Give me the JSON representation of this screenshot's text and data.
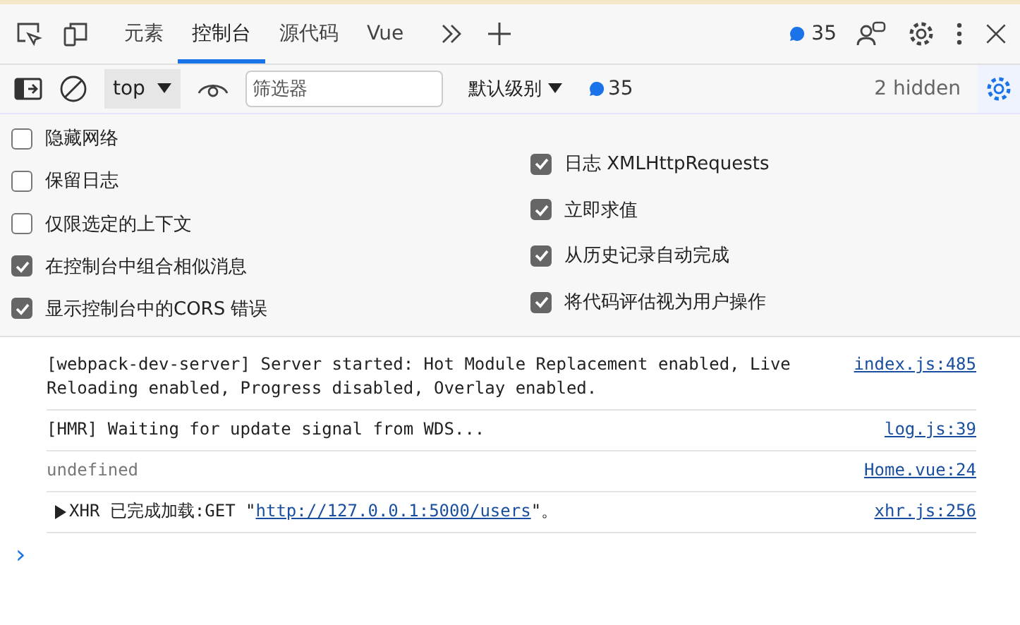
{
  "tabs": [
    {
      "label": "元素",
      "selected": false
    },
    {
      "label": "控制台",
      "selected": true
    },
    {
      "label": "源代码",
      "selected": false
    },
    {
      "label": "Vue",
      "selected": false
    }
  ],
  "tab_message_count": "35",
  "toolbar": {
    "context": "top",
    "filter": {
      "placeholder": "筛选器"
    },
    "level": "默认级别",
    "message_count": "35",
    "hidden": "2 hidden",
    "settings_on": true
  },
  "settings": {
    "left": [
      {
        "label": "隐藏网络",
        "checked": false
      },
      {
        "label": "保留日志",
        "checked": false
      },
      {
        "label": "仅限选定的上下文",
        "checked": false
      },
      {
        "label": "在控制台中组合相似消息",
        "checked": true
      },
      {
        "label": "显示控制台中的CORS 错误",
        "checked": true
      }
    ],
    "right": [
      {
        "label": "日志 XMLHttpRequests",
        "checked": true
      },
      {
        "label": "立即求值",
        "checked": true
      },
      {
        "label": "从历史记录自动完成",
        "checked": true
      },
      {
        "label": "将代码评估视为用户操作",
        "checked": true
      }
    ]
  },
  "messages": [
    {
      "kind": "log",
      "text": "[webpack-dev-server] Server started: Hot Module Replacement enabled, Live Reloading enabled, Progress disabled, Overlay enabled.",
      "source": "index.js:485"
    },
    {
      "kind": "log",
      "text": "[HMR] Waiting for update signal from WDS...",
      "source": "log.js:39"
    },
    {
      "kind": "value",
      "text": "undefined",
      "source": "Home.vue:24"
    },
    {
      "kind": "xhr",
      "text": "XHR 已完成加载:GET \"",
      "url": "http://127.0.0.1:5000/users",
      "suffix": "\"。",
      "source": "xhr.js:256"
    }
  ],
  "prompt": "›"
}
